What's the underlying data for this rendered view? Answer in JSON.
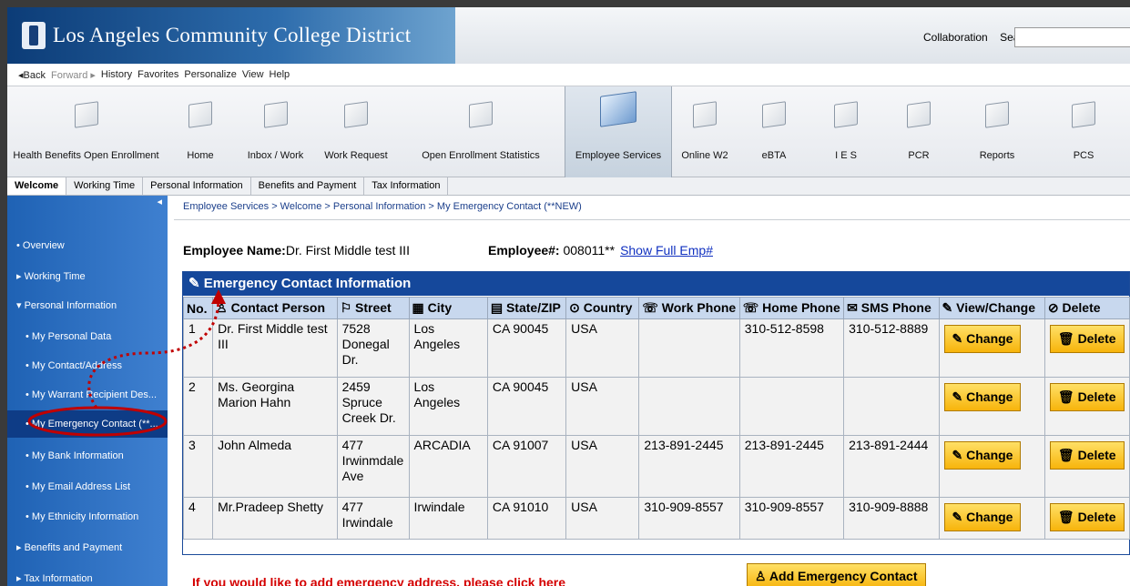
{
  "banner": {
    "title": "Los Angeles Community College District",
    "collab": "Collaboration",
    "search": "Search:"
  },
  "menubar": {
    "back": "◂Back",
    "forward": "Forward ▸",
    "history": "History",
    "favorites": "Favorites",
    "personalize": "Personalize",
    "view": "View",
    "help": "Help"
  },
  "tabs": [
    "Health Benefits Open Enrollment",
    "Home",
    "Inbox / Work",
    "Work Request",
    "Open Enrollment Statistics",
    "Employee Services",
    "Online W2",
    "eBTA",
    "I E S",
    "PCR",
    "Reports",
    "PCS"
  ],
  "subtabs": [
    "Welcome",
    "Working Time",
    "Personal Information",
    "Benefits and Payment",
    "Tax Information"
  ],
  "side": {
    "collapse": "◂",
    "items": [
      "• Overview",
      "▸ Working Time",
      "▾ Personal Information",
      "• My Personal Data",
      "• My Contact/Address",
      "• My Warrant Recipient Des...",
      "• My Emergency Contact (**...",
      "• My Bank Information",
      "• My Email Address List",
      "• My Ethnicity Information",
      "▸ Benefits and Payment",
      "▸ Tax Information"
    ]
  },
  "crumb": "Employee Services  >  Welcome  >  Personal Information  >  My Emergency Contact (**NEW)",
  "employee": {
    "name_label": "Employee Name:",
    "name": "Dr. First Middle test III",
    "num_label": "Employee#:",
    "num": " 008011**",
    "show": "Show Full Emp#"
  },
  "panel": {
    "title": "Emergency Contact Information"
  },
  "table": {
    "headers": [
      "No.",
      "Contact Person",
      "Street",
      "City",
      "State/ZIP",
      "Country",
      "Work Phone",
      "Home Phone",
      "SMS Phone",
      "View/Change",
      "Delete"
    ],
    "rows": [
      [
        "1",
        "Dr. First Middle test III",
        "7528 Donegal Dr.",
        "Los Angeles",
        "CA 90045",
        "USA",
        "",
        "310-512-8598",
        "310-512-8889"
      ],
      [
        "2",
        "Ms. Georgina Marion Hahn",
        "2459 Spruce Creek Dr.",
        "Los Angeles",
        "CA 90045",
        "USA",
        "",
        "",
        ""
      ],
      [
        "3",
        "John Almeda",
        "477 Irwinmdale Ave",
        "ARCADIA",
        "CA 91007",
        "USA",
        "213-891-2445",
        "213-891-2445",
        "213-891-2444"
      ],
      [
        "4",
        "Mr.Pradeep Shetty",
        "477 Irwindale",
        "Irwindale",
        "CA 91010",
        "USA",
        "310-909-8557",
        "310-909-8557",
        "310-909-8888"
      ]
    ],
    "change": "Change",
    "delete": "Delete"
  },
  "add_button": "Add Emergency Contact",
  "note": "If you would like to add emergency address, please click here"
}
